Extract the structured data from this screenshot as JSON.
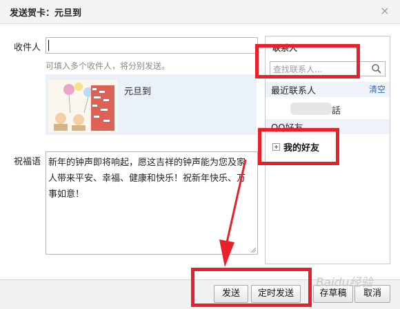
{
  "dialog": {
    "title": "发送贺卡：元旦到",
    "close_label": "×"
  },
  "form": {
    "to_label": "收件人",
    "to_value": "",
    "to_hint": "可填入多个收件人，将分别发送。",
    "card_name": "元旦到",
    "greeting_label": "祝福语",
    "greeting_text": "新年的钟声即将响起，愿这吉祥的钟声能为您及家人带来平安、幸福、健康和快乐！祝新年快乐、万事如意！"
  },
  "contacts": {
    "title": "联系人",
    "search_placeholder": "查找联系人...",
    "recent_label": "最近联系人",
    "clear_label": "清空",
    "recent_item_suffix": "話",
    "group_label": "QQ好友",
    "friends_label": "我的好友"
  },
  "buttons": {
    "send": "发送",
    "schedule": "定时发送",
    "draft": "存草稿",
    "cancel": "取消"
  },
  "watermark": "Baidu经验",
  "colors": {
    "highlight": "#e8202a",
    "card_bg": "#eaf1f9",
    "link": "#2a6ab8"
  }
}
